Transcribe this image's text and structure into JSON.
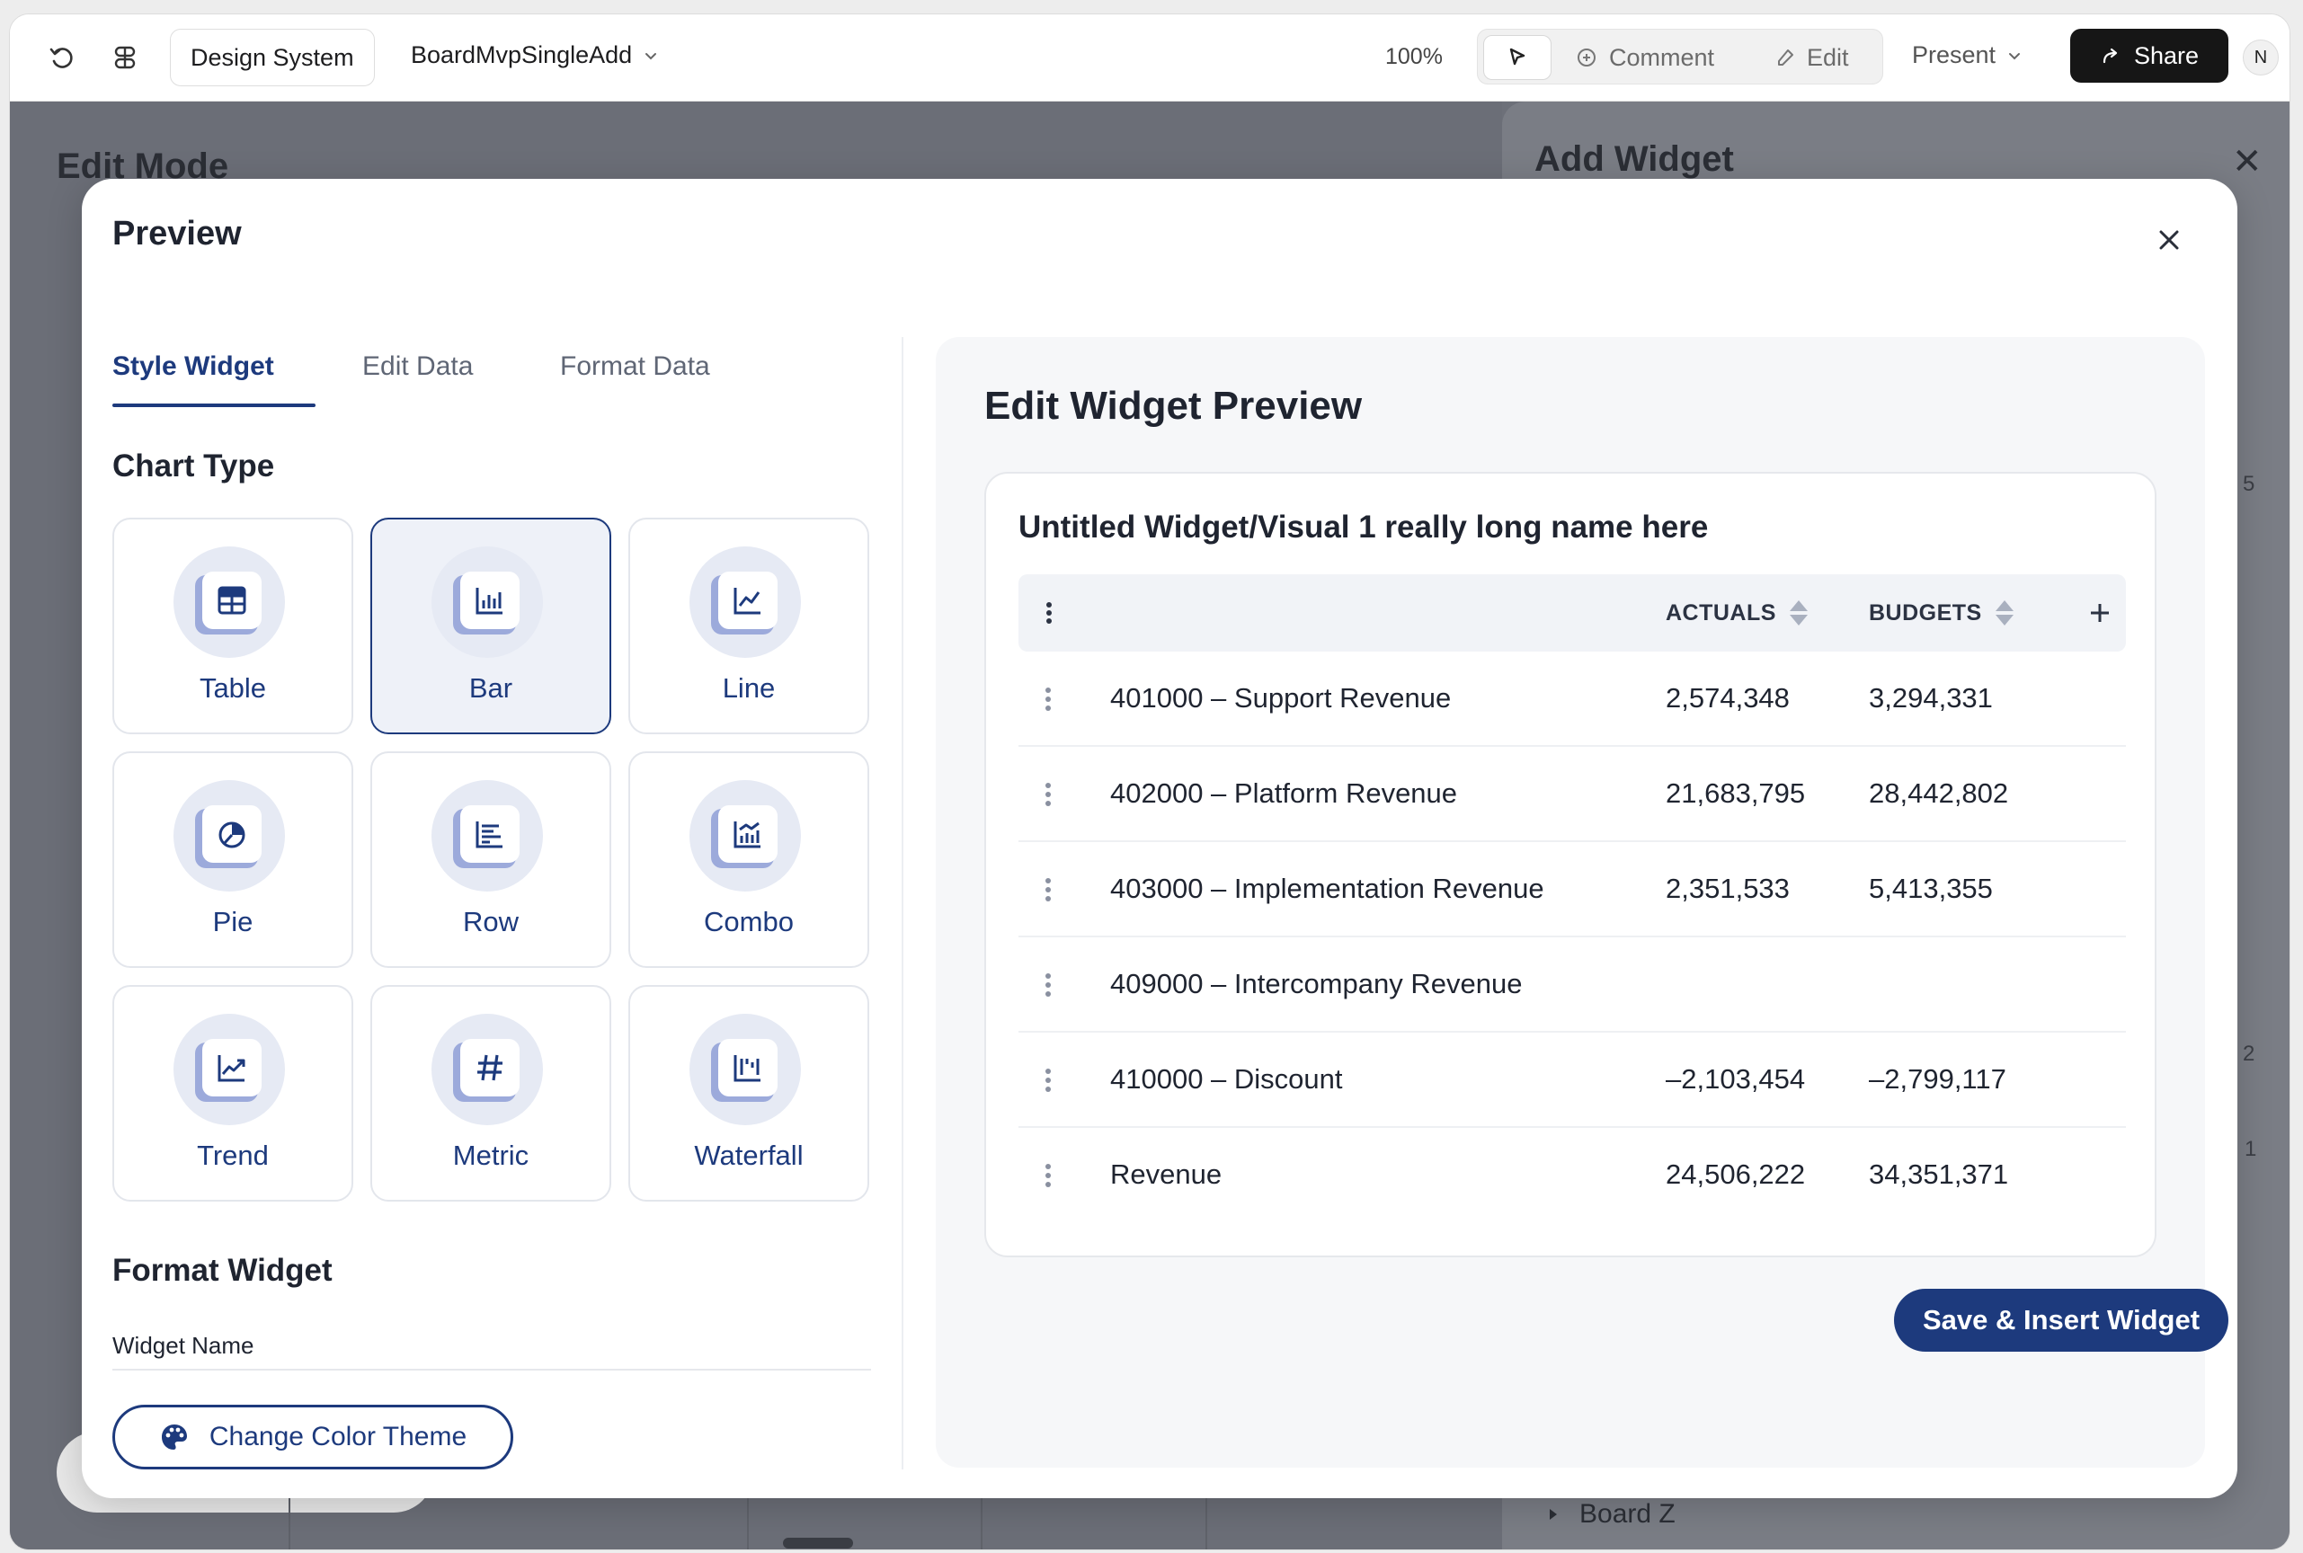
{
  "toolbar": {
    "project": "Design System",
    "file": "BoardMvpSingleAdd",
    "zoom": "100%",
    "comment": "Comment",
    "edit": "Edit",
    "present": "Present",
    "share": "Share",
    "avatar": "N"
  },
  "background": {
    "left_title": "Edit Mode",
    "right_title": "Add Widget",
    "numbers": [
      "5",
      "2",
      "1"
    ],
    "board": "Board Z"
  },
  "modal": {
    "title": "Preview",
    "tabs": [
      {
        "label": "Style Widget",
        "active": true
      },
      {
        "label": "Edit Data",
        "active": false
      },
      {
        "label": "Format Data",
        "active": false
      }
    ],
    "chart_type_heading": "Chart Type",
    "chart_types": [
      {
        "label": "Table",
        "icon": "table-icon",
        "selected": false
      },
      {
        "label": "Bar",
        "icon": "bar-chart-icon",
        "selected": true
      },
      {
        "label": "Line",
        "icon": "line-chart-icon",
        "selected": false
      },
      {
        "label": "Pie",
        "icon": "pie-chart-icon",
        "selected": false
      },
      {
        "label": "Row",
        "icon": "row-chart-icon",
        "selected": false
      },
      {
        "label": "Combo",
        "icon": "combo-chart-icon",
        "selected": false
      },
      {
        "label": "Trend",
        "icon": "trend-icon",
        "selected": false
      },
      {
        "label": "Metric",
        "icon": "hash-icon",
        "selected": false
      },
      {
        "label": "Waterfall",
        "icon": "waterfall-icon",
        "selected": false
      }
    ],
    "format_heading": "Format Widget",
    "widget_name_label": "Widget Name",
    "theme_button": "Change Color Theme"
  },
  "preview": {
    "title": "Edit Widget Preview",
    "widget_title": "Untitled Widget/Visual 1 really long name here",
    "columns": [
      "ACTUALS",
      "BUDGETS"
    ],
    "rows": [
      {
        "name": "401000 – Support Revenue",
        "actuals": "2,574,348",
        "budgets": "3,294,331"
      },
      {
        "name": "402000 – Platform Revenue",
        "actuals": "21,683,795",
        "budgets": "28,442,802"
      },
      {
        "name": "403000 – Implementation Revenue",
        "actuals": "2,351,533",
        "budgets": "5,413,355"
      },
      {
        "name": "409000 – Intercompany Revenue",
        "actuals": "",
        "budgets": ""
      },
      {
        "name": "410000 – Discount",
        "actuals": "–2,103,454",
        "budgets": "–2,799,117"
      },
      {
        "name": "Revenue",
        "actuals": "24,506,222",
        "budgets": "34,351,371"
      }
    ],
    "save_button": "Save & Insert Widget"
  },
  "colors": {
    "accent": "#1d3a7d",
    "icon_tint": "#9caadb"
  }
}
